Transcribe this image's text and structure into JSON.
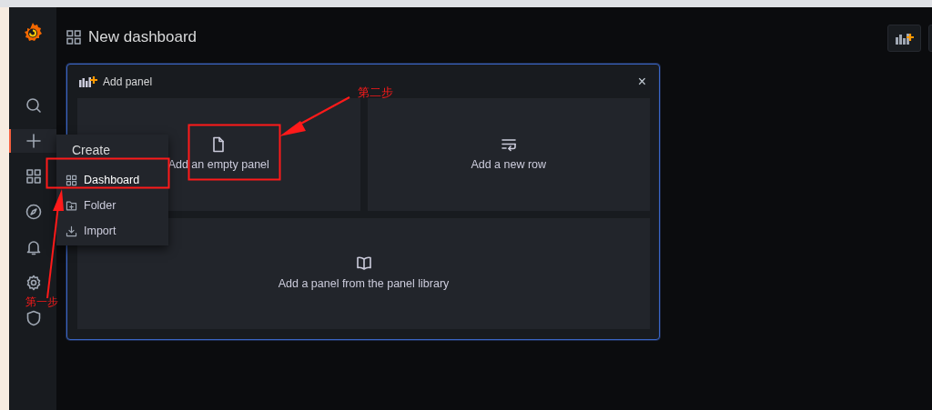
{
  "header": {
    "title": "New dashboard"
  },
  "sidebar": {
    "items": [
      {
        "kind": "search",
        "selected": false
      },
      {
        "kind": "create",
        "selected": true
      },
      {
        "kind": "dashboards",
        "selected": false
      },
      {
        "kind": "explore",
        "selected": false
      },
      {
        "kind": "alerting",
        "selected": false
      },
      {
        "kind": "configuration",
        "selected": false
      },
      {
        "kind": "admin",
        "selected": false
      }
    ]
  },
  "create_menu": {
    "title": "Create",
    "items": [
      {
        "label": "Dashboard",
        "kind": "dashboard"
      },
      {
        "label": "Folder",
        "kind": "folder"
      },
      {
        "label": "Import",
        "kind": "import"
      }
    ]
  },
  "add_panel": {
    "title": "Add panel",
    "close": "×",
    "options": [
      {
        "label": "Add an empty panel",
        "kind": "empty"
      },
      {
        "label": "Add a new row",
        "kind": "row"
      },
      {
        "label": "Add a panel from the panel library",
        "kind": "library"
      }
    ]
  },
  "annotations": [
    {
      "label": "第一步"
    },
    {
      "label": "第二步"
    }
  ]
}
